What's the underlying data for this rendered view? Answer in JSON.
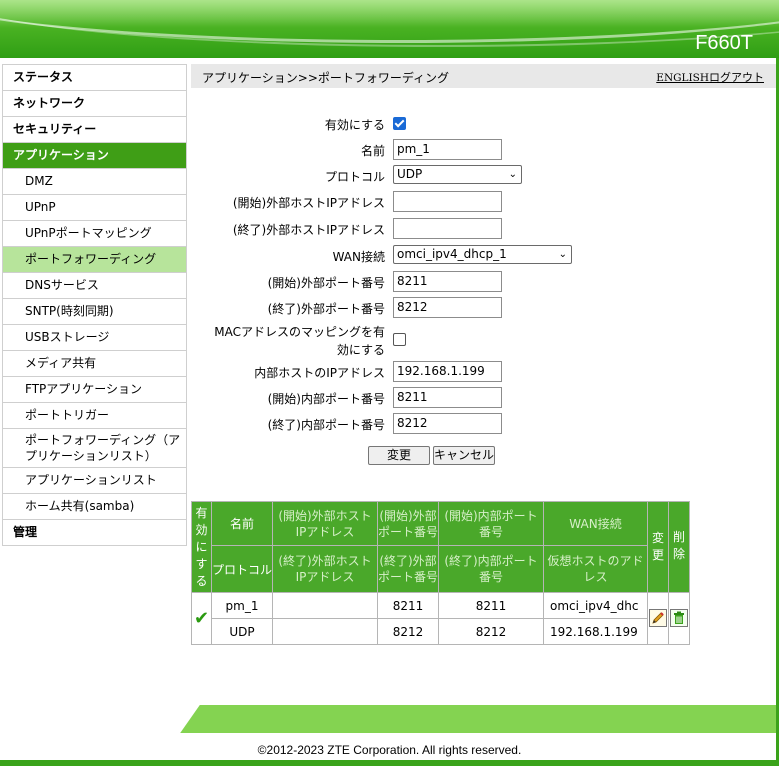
{
  "header": {
    "model": "F660T"
  },
  "sidebar": {
    "items": [
      {
        "label": "ステータス"
      },
      {
        "label": "ネットワーク"
      },
      {
        "label": "セキュリティー"
      },
      {
        "label": "アプリケーション"
      }
    ],
    "sub_items": [
      {
        "label": "DMZ"
      },
      {
        "label": "UPnP"
      },
      {
        "label": "UPnPポートマッピング"
      },
      {
        "label": "ポートフォワーディング"
      },
      {
        "label": "DNSサービス"
      },
      {
        "label": "SNTP(時刻同期)"
      },
      {
        "label": "USBストレージ"
      },
      {
        "label": "メディア共有"
      },
      {
        "label": "FTPアプリケーション"
      },
      {
        "label": "ポートトリガー"
      },
      {
        "label": "ポートフォワーディング（アプリケーションリスト）"
      },
      {
        "label": "アプリケーションリスト"
      },
      {
        "label": "ホーム共有(samba)"
      }
    ],
    "admin_label": "管理"
  },
  "breadcrumb": "アプリケーション>>ポートフォワーディング",
  "top_links": {
    "english": "ENGLISH",
    "logout": "ログアウト"
  },
  "form": {
    "enable_label": "有効にする",
    "enable_checked": true,
    "name_label": "名前",
    "name_value": "pm_1",
    "protocol_label": "プロトコル",
    "protocol_value": "UDP",
    "wan_host_start_label": "(開始)外部ホストIPアドレス",
    "wan_host_start_value": "",
    "wan_host_end_label": "(終了)外部ホストIPアドレス",
    "wan_host_end_value": "",
    "wan_conn_label": "WAN接続",
    "wan_conn_value": "omci_ipv4_dhcp_1",
    "wan_port_start_label": "(開始)外部ポート番号",
    "wan_port_start_value": "8211",
    "wan_port_end_label": "(終了)外部ポート番号",
    "wan_port_end_value": "8212",
    "mac_mapping_label_1": "MACアドレスのマッピングを有",
    "mac_mapping_label_2": "効にする",
    "mac_mapping_checked": false,
    "lan_host_label": "内部ホストのIPアドレス",
    "lan_host_value": "192.168.1.199",
    "lan_port_start_label": "(開始)内部ポート番号",
    "lan_port_start_value": "8211",
    "lan_port_end_label": "(終了)内部ポート番号",
    "lan_port_end_value": "8212",
    "apply_label": "変更",
    "cancel_label": "キャンセル"
  },
  "table": {
    "headers": {
      "enable": "有効にする",
      "name": "名前",
      "wan_host_start": "(開始)外部ホストIPアドレス",
      "wan_port_start": "(開始)外部ポート番号",
      "lan_port_start": "(開始)内部ポート番号",
      "wan_conn": "WAN接続",
      "edit": "変更",
      "delete": "削除",
      "protocol": "プロトコル",
      "wan_host_end": "(終了)外部ホストIPアドレス",
      "wan_port_end": "(終了)外部ポート番号",
      "lan_port_end": "(終了)内部ポート番号",
      "virtual_host": "仮想ホストのアドレス"
    },
    "row": {
      "name": "pm_1",
      "wan_host_start": "",
      "wan_port_start": "8211",
      "lan_port_start": "8211",
      "wan_conn": "omci_ipv4_dhc",
      "protocol": "UDP",
      "wan_host_end": "",
      "wan_port_end": "8212",
      "lan_port_end": "8212",
      "virtual_host": "192.168.1.199",
      "enabled": true
    }
  },
  "footer": {
    "copyright": "©2012-2023 ZTE Corporation. All rights reserved."
  },
  "colors": {
    "brand_green": "#4bb323",
    "active_nav": "#3f9e16",
    "active_sub": "#b7e49b",
    "table_header": "#4aa82a"
  },
  "icons": {
    "checkmark": "check-icon",
    "edit": "pencil-icon",
    "delete": "trash-icon"
  }
}
